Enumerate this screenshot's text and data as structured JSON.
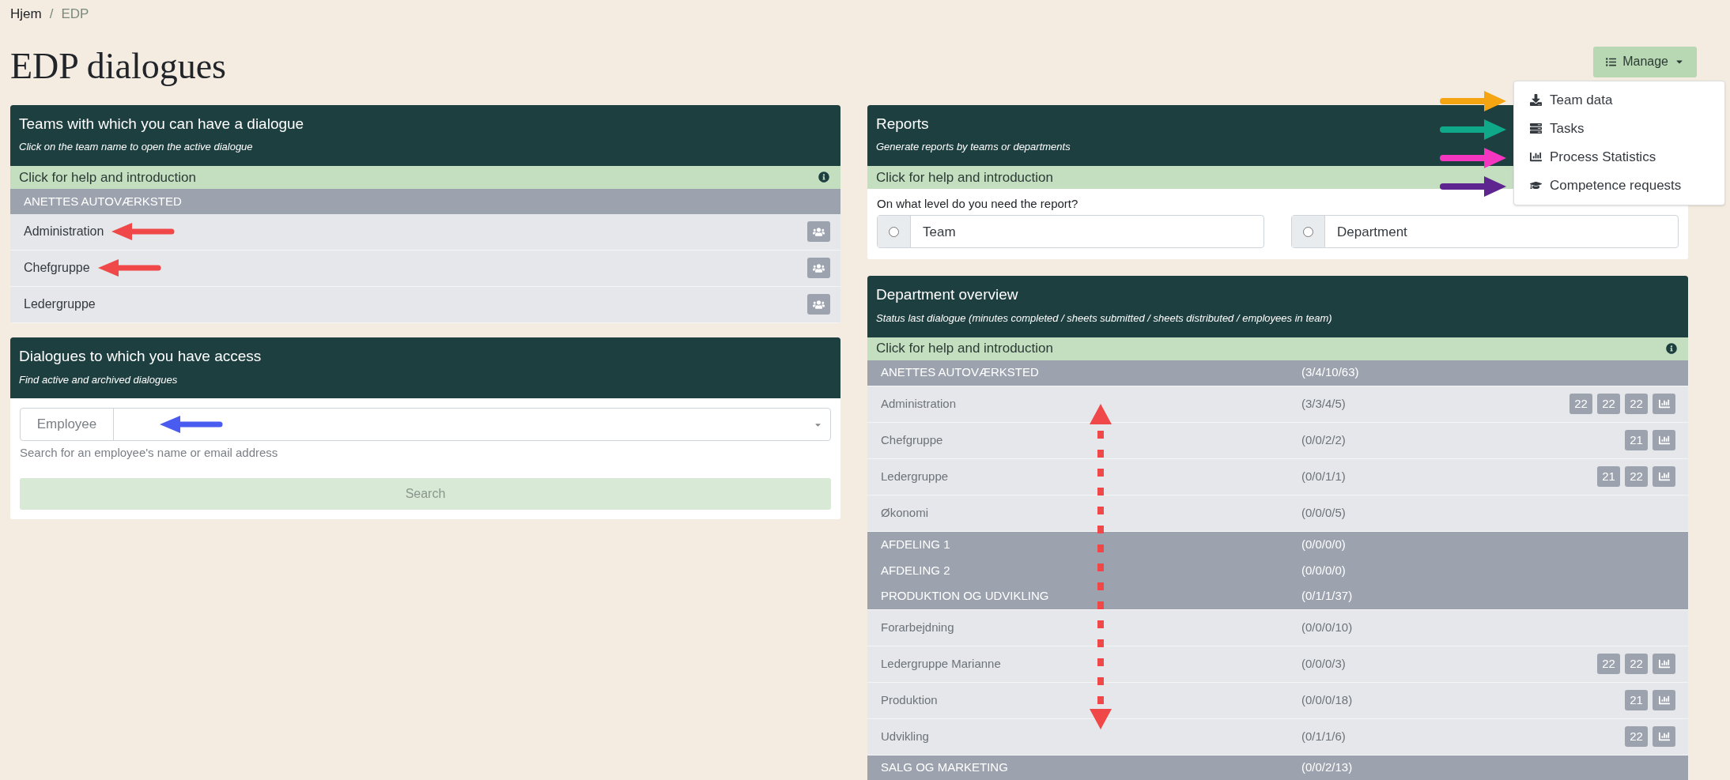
{
  "breadcrumb": [
    {
      "label": "Hjem",
      "current": false
    },
    {
      "label": "EDP",
      "current": true
    }
  ],
  "breadcrumb_separator": "/",
  "title": "EDP dialogues",
  "manage": {
    "label": "Manage",
    "expanded": true,
    "items": [
      {
        "label": "Team data",
        "arrow": {
          "color": "#f5a511"
        }
      },
      {
        "label": "Tasks",
        "arrow": {
          "color": "#0fa98a"
        }
      },
      {
        "label": "Process Statistics",
        "arrow": {
          "color": "#f536c0"
        }
      },
      {
        "label": "Competence requests",
        "arrow": {
          "color": "#5e2590"
        }
      }
    ]
  },
  "teams_panel": {
    "title": "Teams with which you can have a dialogue",
    "subtitle": "Click on the team name to open the active dialogue",
    "help": "Click for help and introduction",
    "group": "ANETTES AUTOVÆRKSTED",
    "rows": [
      {
        "name": "Administration",
        "arrow": {
          "color": "#f04848"
        }
      },
      {
        "name": "Chefgruppe",
        "arrow": {
          "color": "#f04848"
        }
      },
      {
        "name": "Ledergruppe"
      }
    ]
  },
  "access_panel": {
    "title": "Dialogues to which you have access",
    "subtitle": "Find active and archived dialogues",
    "field_label": "Employee",
    "arrow": {
      "color": "#4a5cf0"
    },
    "hint": "Search for an employee's name or email address",
    "button": {
      "label": "Search",
      "disabled": true
    }
  },
  "reports_panel": {
    "title": "Reports",
    "subtitle": "Generate reports by teams or departments",
    "help": "Click for help and introduction",
    "question": "On what level do you need the report?",
    "options": [
      {
        "label": "Team",
        "selected": false
      },
      {
        "label": "Department",
        "selected": false
      }
    ]
  },
  "overview_panel": {
    "title": "Department overview",
    "subtitle": "Status last dialogue (minutes completed / sheets submitted / sheets distributed / employees in team)",
    "help": "Click for help and introduction",
    "arrow": {
      "color": "#f04848"
    },
    "rows": [
      {
        "kind": "group",
        "name": "ANETTES AUTOVÆRKSTED",
        "status": "(3/4/10/63)"
      },
      {
        "kind": "team",
        "name": "Administration",
        "status": "(3/3/4/5)",
        "badges": [
          "22",
          "22",
          "22"
        ],
        "stats": true
      },
      {
        "kind": "team",
        "name": "Chefgruppe",
        "status": "(0/0/2/2)",
        "badges": [
          "21"
        ],
        "stats": true
      },
      {
        "kind": "team",
        "name": "Ledergruppe",
        "status": "(0/0/1/1)",
        "badges": [
          "21",
          "22"
        ],
        "stats": true
      },
      {
        "kind": "team",
        "name": "Økonomi",
        "status": "(0/0/0/5)",
        "stats": false
      },
      {
        "kind": "group",
        "name": "AFDELING 1",
        "status": "(0/0/0/0)"
      },
      {
        "kind": "group",
        "name": "AFDELING 2",
        "status": "(0/0/0/0)"
      },
      {
        "kind": "group",
        "name": "PRODUKTION OG UDVIKLING",
        "status": "(0/1/1/37)"
      },
      {
        "kind": "team",
        "name": "Forarbejdning",
        "status": "(0/0/0/10)",
        "stats": false
      },
      {
        "kind": "team",
        "name": "Ledergruppe Marianne",
        "status": "(0/0/0/3)",
        "badges": [
          "22",
          "22"
        ],
        "stats": true
      },
      {
        "kind": "team",
        "name": "Produktion",
        "status": "(0/0/0/18)",
        "badges": [
          "21"
        ],
        "stats": true
      },
      {
        "kind": "team",
        "name": "Udvikling",
        "status": "(0/1/1/6)",
        "badges": [
          "22"
        ],
        "stats": true
      },
      {
        "kind": "group",
        "name": "SALG OG MARKETING",
        "status": "(0/0/2/13)"
      }
    ]
  }
}
